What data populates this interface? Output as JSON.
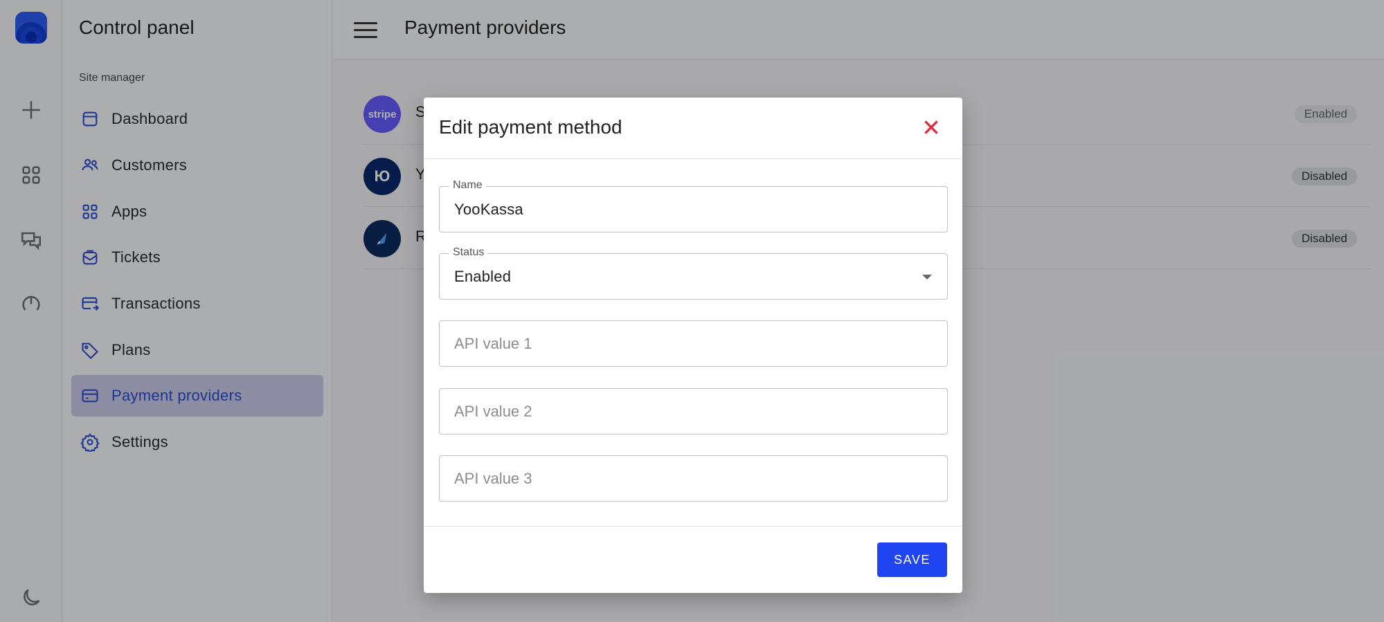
{
  "app": {
    "title": "Control panel",
    "section_label": "Site manager"
  },
  "rail": {
    "items": [
      {
        "name": "plus-icon"
      },
      {
        "name": "apps-grid-icon"
      },
      {
        "name": "chat-bubbles-icon"
      },
      {
        "name": "gauge-icon"
      },
      {
        "name": "moon-icon"
      }
    ]
  },
  "sidebar": {
    "items": [
      {
        "label": "Dashboard",
        "icon": "calendar-icon"
      },
      {
        "label": "Customers",
        "icon": "users-icon"
      },
      {
        "label": "Apps",
        "icon": "apps-grid-icon"
      },
      {
        "label": "Tickets",
        "icon": "mail-inbox-icon"
      },
      {
        "label": "Transactions",
        "icon": "card-transfer-icon"
      },
      {
        "label": "Plans",
        "icon": "tag-icon"
      },
      {
        "label": "Payment providers",
        "icon": "credit-card-icon",
        "active": true
      },
      {
        "label": "Settings",
        "icon": "gear-icon"
      }
    ]
  },
  "header": {
    "title": "Payment providers"
  },
  "providers": [
    {
      "logo_text": "stripe",
      "name_initial": "S",
      "status": "Enabled",
      "logo_color": "#635bff"
    },
    {
      "logo_text": "Ю",
      "name_initial": "Y",
      "status": "Disabled",
      "logo_color": "#0a2a6e"
    },
    {
      "logo_text": "",
      "name_initial": "R",
      "status": "Disabled",
      "logo_color": "#0b2a5e"
    }
  ],
  "modal": {
    "title": "Edit payment method",
    "name_field": {
      "label": "Name",
      "value": "YooKassa"
    },
    "status_field": {
      "label": "Status",
      "value": "Enabled"
    },
    "api1": {
      "placeholder": "API value 1"
    },
    "api2": {
      "placeholder": "API value 2"
    },
    "api3": {
      "placeholder": "API value 3"
    },
    "save_label": "SAVE"
  },
  "colors": {
    "accent": "#1f45f2",
    "close": "#e02b40",
    "active_bg": "#c9cbe8"
  }
}
